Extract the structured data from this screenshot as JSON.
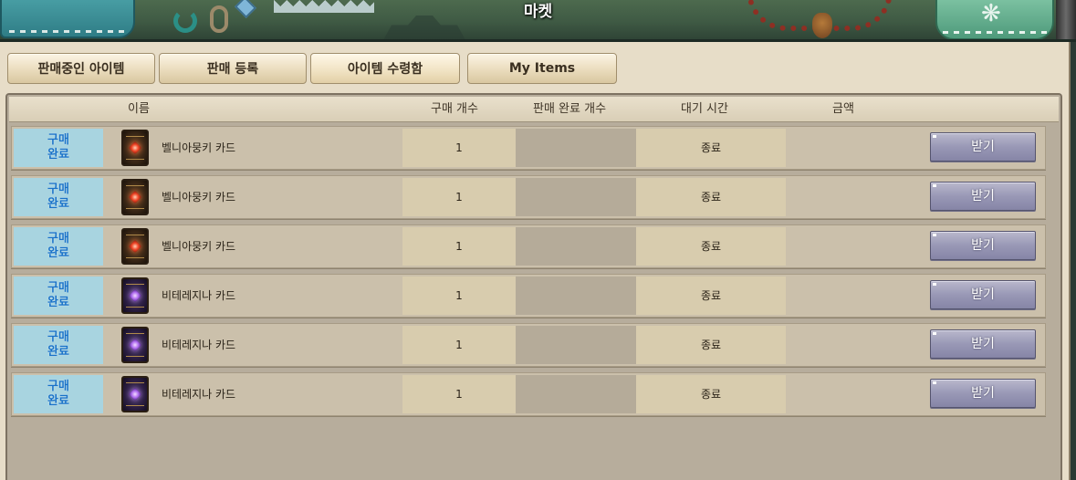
{
  "window": {
    "title": "마켓"
  },
  "tabs": [
    {
      "label": "판매중인 아이템",
      "active": false
    },
    {
      "label": "판매 등록",
      "active": false
    },
    {
      "label": "아이템 수령함",
      "active": true
    },
    {
      "label": "My Items",
      "active": false
    }
  ],
  "columns": {
    "name": "이름",
    "buy_count": "구매 개수",
    "sold_count": "판매 완료 개수",
    "wait_time": "대기 시간",
    "amount": "금액"
  },
  "rows": [
    {
      "status_line1": "구매",
      "status_line2": "완료",
      "icon": "red-gem-card-icon",
      "name": "벨니아뭉키 카드",
      "buy_count": "1",
      "sold_count": "",
      "wait_time": "종료",
      "amount": "",
      "button": "받기"
    },
    {
      "status_line1": "구매",
      "status_line2": "완료",
      "icon": "red-gem-card-icon",
      "name": "벨니아뭉키 카드",
      "buy_count": "1",
      "sold_count": "",
      "wait_time": "종료",
      "amount": "",
      "button": "받기"
    },
    {
      "status_line1": "구매",
      "status_line2": "완료",
      "icon": "red-gem-card-icon",
      "name": "벨니아뭉키 카드",
      "buy_count": "1",
      "sold_count": "",
      "wait_time": "종료",
      "amount": "",
      "button": "받기"
    },
    {
      "status_line1": "구매",
      "status_line2": "완료",
      "icon": "purple-gem-card-icon",
      "name": "비테레지나 카드",
      "buy_count": "1",
      "sold_count": "",
      "wait_time": "종료",
      "amount": "",
      "button": "받기"
    },
    {
      "status_line1": "구매",
      "status_line2": "완료",
      "icon": "purple-gem-card-icon",
      "name": "비테레지나 카드",
      "buy_count": "1",
      "sold_count": "",
      "wait_time": "종료",
      "amount": "",
      "button": "받기"
    },
    {
      "status_line1": "구매",
      "status_line2": "완료",
      "icon": "purple-gem-card-icon",
      "name": "비테레지나 카드",
      "buy_count": "1",
      "sold_count": "",
      "wait_time": "종료",
      "amount": "",
      "button": "받기"
    }
  ],
  "colors": {
    "status_badge_bg": "#a8d4e0",
    "status_text": "#1872c8",
    "button_bg": "#9998b6"
  }
}
